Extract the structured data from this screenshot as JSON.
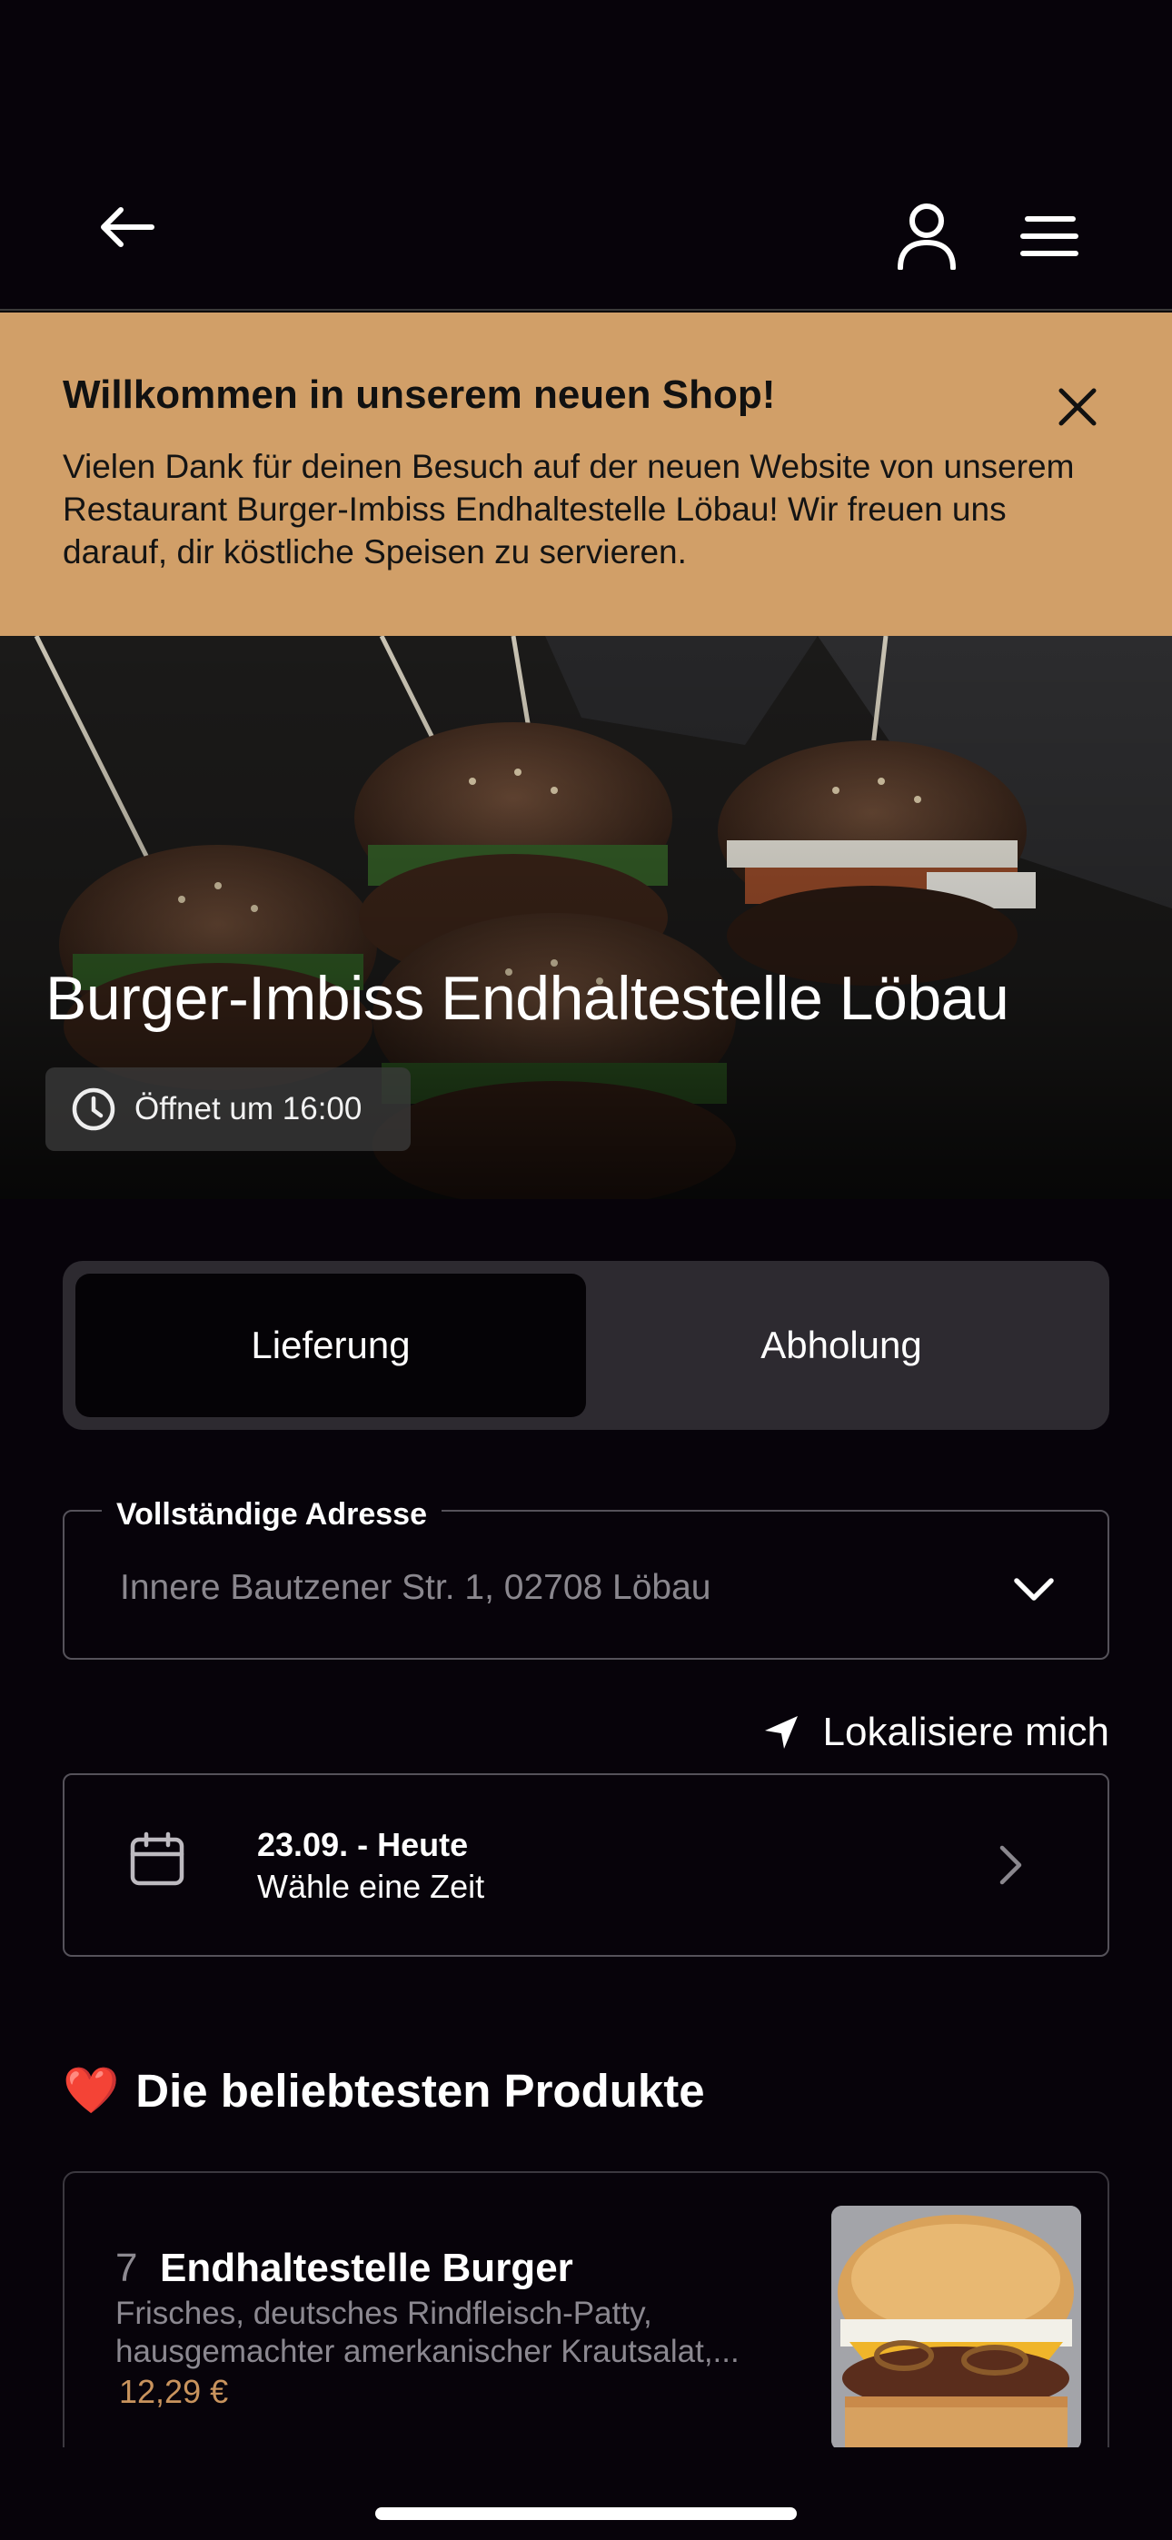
{
  "header": {
    "back_icon": "arrow-left-icon",
    "account_icon": "user-icon",
    "menu_icon": "hamburger-menu-icon"
  },
  "banner": {
    "title": "Willkommen in unserem neuen Shop!",
    "text": "Vielen Dank für deinen Besuch auf der neuen Website von unserem Restaurant Burger-Imbiss Endhaltestelle Löbau! Wir freuen uns darauf, dir köstliche Speisen zu servieren.",
    "close_icon": "close-icon",
    "color": "#d19f68"
  },
  "hero": {
    "restaurant_name": "Burger-Imbiss Endhaltestelle Löbau",
    "opening_status": "Öffnet um 16:00"
  },
  "order_mode": {
    "options": [
      "Lieferung",
      "Abholung"
    ],
    "selected": "Lieferung"
  },
  "address": {
    "label": "Vollständige Adresse",
    "value": "Innere Bautzener Str. 1, 02708 Löbau",
    "locate_label": "Lokalisiere mich"
  },
  "schedule": {
    "date": "23.09. - Heute",
    "subtitle": "Wähle eine Zeit"
  },
  "popular": {
    "emoji": "❤️",
    "title": "Die beliebtesten Produkte",
    "products": [
      {
        "number": "7",
        "name": "Endhaltestelle Burger",
        "description": "Frisches, deutsches Rindfleisch-Patty, hausgemachter amerkanischer Krautsalat,...",
        "price": "12,29 €"
      }
    ]
  },
  "colors": {
    "background": "#07030a",
    "accent_price": "#c8935d",
    "toggle_bg": "#2d2a30"
  }
}
